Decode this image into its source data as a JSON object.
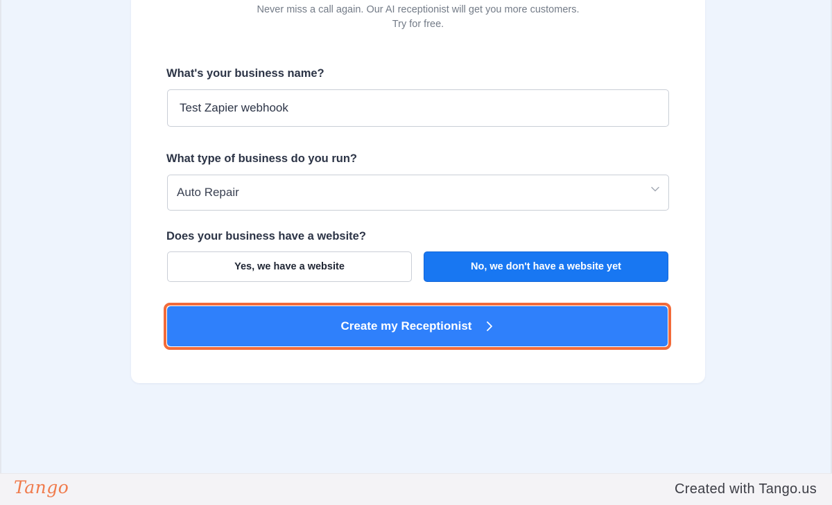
{
  "header": {
    "subtitle_line1": "Never miss a call again. Our AI receptionist will get you more customers.",
    "subtitle_line2": "Try for free."
  },
  "form": {
    "business_name": {
      "label": "What's your business name?",
      "value": "Test Zapier webhook"
    },
    "business_type": {
      "label": "What type of business do you run?",
      "selected": "Auto Repair"
    },
    "website": {
      "label": "Does your business have a website?",
      "option_yes": "Yes, we have a website",
      "option_no": "No, we don't have a website yet",
      "selected": "no"
    },
    "submit_label": "Create my Receptionist"
  },
  "footer": {
    "logo_text": "Tango",
    "credit": "Created with Tango.us"
  },
  "colors": {
    "primary": "#2f80fb",
    "selected_option": "#1877f2",
    "highlight": "#f26b3a",
    "background": "#eef4fd"
  }
}
